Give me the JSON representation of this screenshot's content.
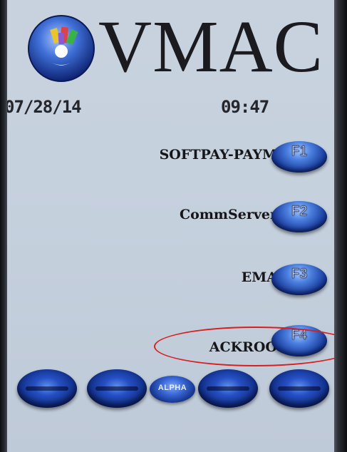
{
  "header": {
    "title": "VMAC",
    "date": "07/28/14",
    "time": "09:47"
  },
  "menu": [
    {
      "label": "SOFTPAY-PAYM",
      "key": "F1"
    },
    {
      "label": "CommServer",
      "key": "F2"
    },
    {
      "label": "EMA",
      "key": "F3"
    },
    {
      "label": "ACKROO",
      "key": "F4"
    }
  ],
  "bottom_keys": {
    "alpha_label": "ALPHA"
  },
  "colors": {
    "screen_bg": "#c6d1de",
    "key_blue": "#1c3fa0",
    "annotation_red": "#d81e1e"
  },
  "icons": {
    "logo": "vmac-logo-icon"
  }
}
